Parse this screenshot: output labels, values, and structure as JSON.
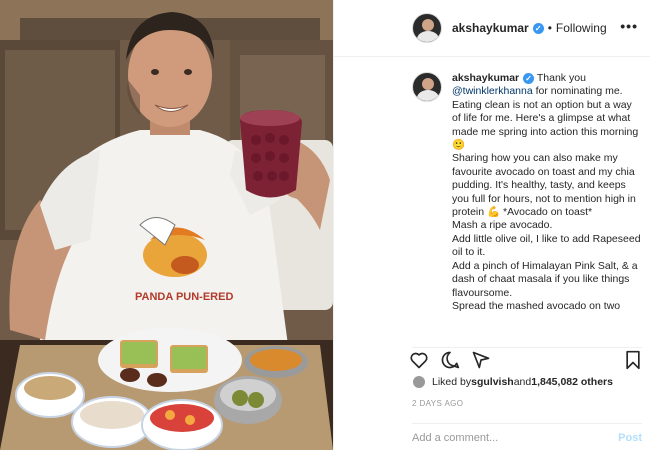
{
  "header": {
    "username": "akshaykumar",
    "separator": "•",
    "follow_status": "Following",
    "more_label": "•••"
  },
  "caption": {
    "username": "akshaykumar",
    "line1": "Thank you",
    "mention": "@twinklerkhanna",
    "body": " for nominating me. Eating clean is not an option but a way of life for me. Here's a glimpse at what made me spring into action this morning 🙂\nSharing how you can also make my favourite avocado on toast and my chia pudding. It's healthy, tasty, and keeps you full for hours, not to mention high in protein 💪 *Avocado on toast*\nMash a ripe avocado.\nAdd little olive oil, I like to add Rapeseed oil to it.\nAdd a pinch of Himalayan Pink Salt, & a dash of chaat masala if you like things flavoursome.\nSpread the mashed avocado on two"
  },
  "actions": {
    "like_icon": "heart-icon",
    "comment_icon": "comment-icon",
    "share_icon": "share-icon",
    "save_icon": "bookmark-icon"
  },
  "likes": {
    "prefix": "Liked by ",
    "user": "sgulvish",
    "middle": " and ",
    "count": "1,845,082 others"
  },
  "date": "2 DAYS AGO",
  "comment_box": {
    "placeholder": "Add a comment...",
    "post_label": "Post"
  },
  "media": {
    "tshirt_text": "PANDA PUN-ERED",
    "accent": "#3897f0"
  }
}
